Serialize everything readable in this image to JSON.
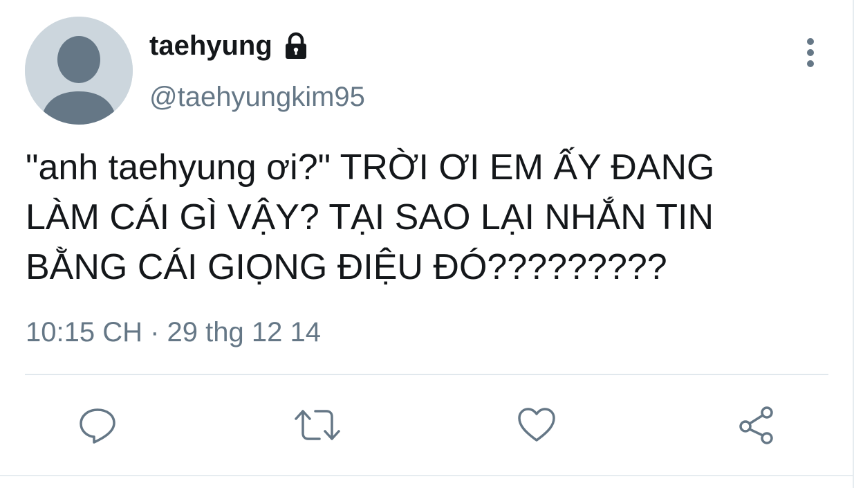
{
  "tweet": {
    "display_name": "taehyung",
    "protected_icon": "lock-icon",
    "handle": "@taehyungkim95",
    "text": "\"anh taehyung ơi?\" TRỜI ƠI EM ẤY ĐANG\nLÀM CÁI GÌ VẬY? TẠI SAO LẠI NHẮN TIN\nBẰNG CÁI GIỌNG ĐIỆU ĐÓ?????????",
    "timestamp": "10:15 CH · 29 thg 12 14"
  },
  "icons": {
    "more": "more-vertical-icon",
    "reply": "reply-icon",
    "retweet": "retweet-icon",
    "like": "heart-icon",
    "share": "share-icon"
  },
  "colors": {
    "primary_text": "#14171a",
    "secondary_text": "#657786",
    "avatar_bg": "#ccd6dd",
    "avatar_figure": "#657786",
    "divider": "#e1e8ed"
  }
}
